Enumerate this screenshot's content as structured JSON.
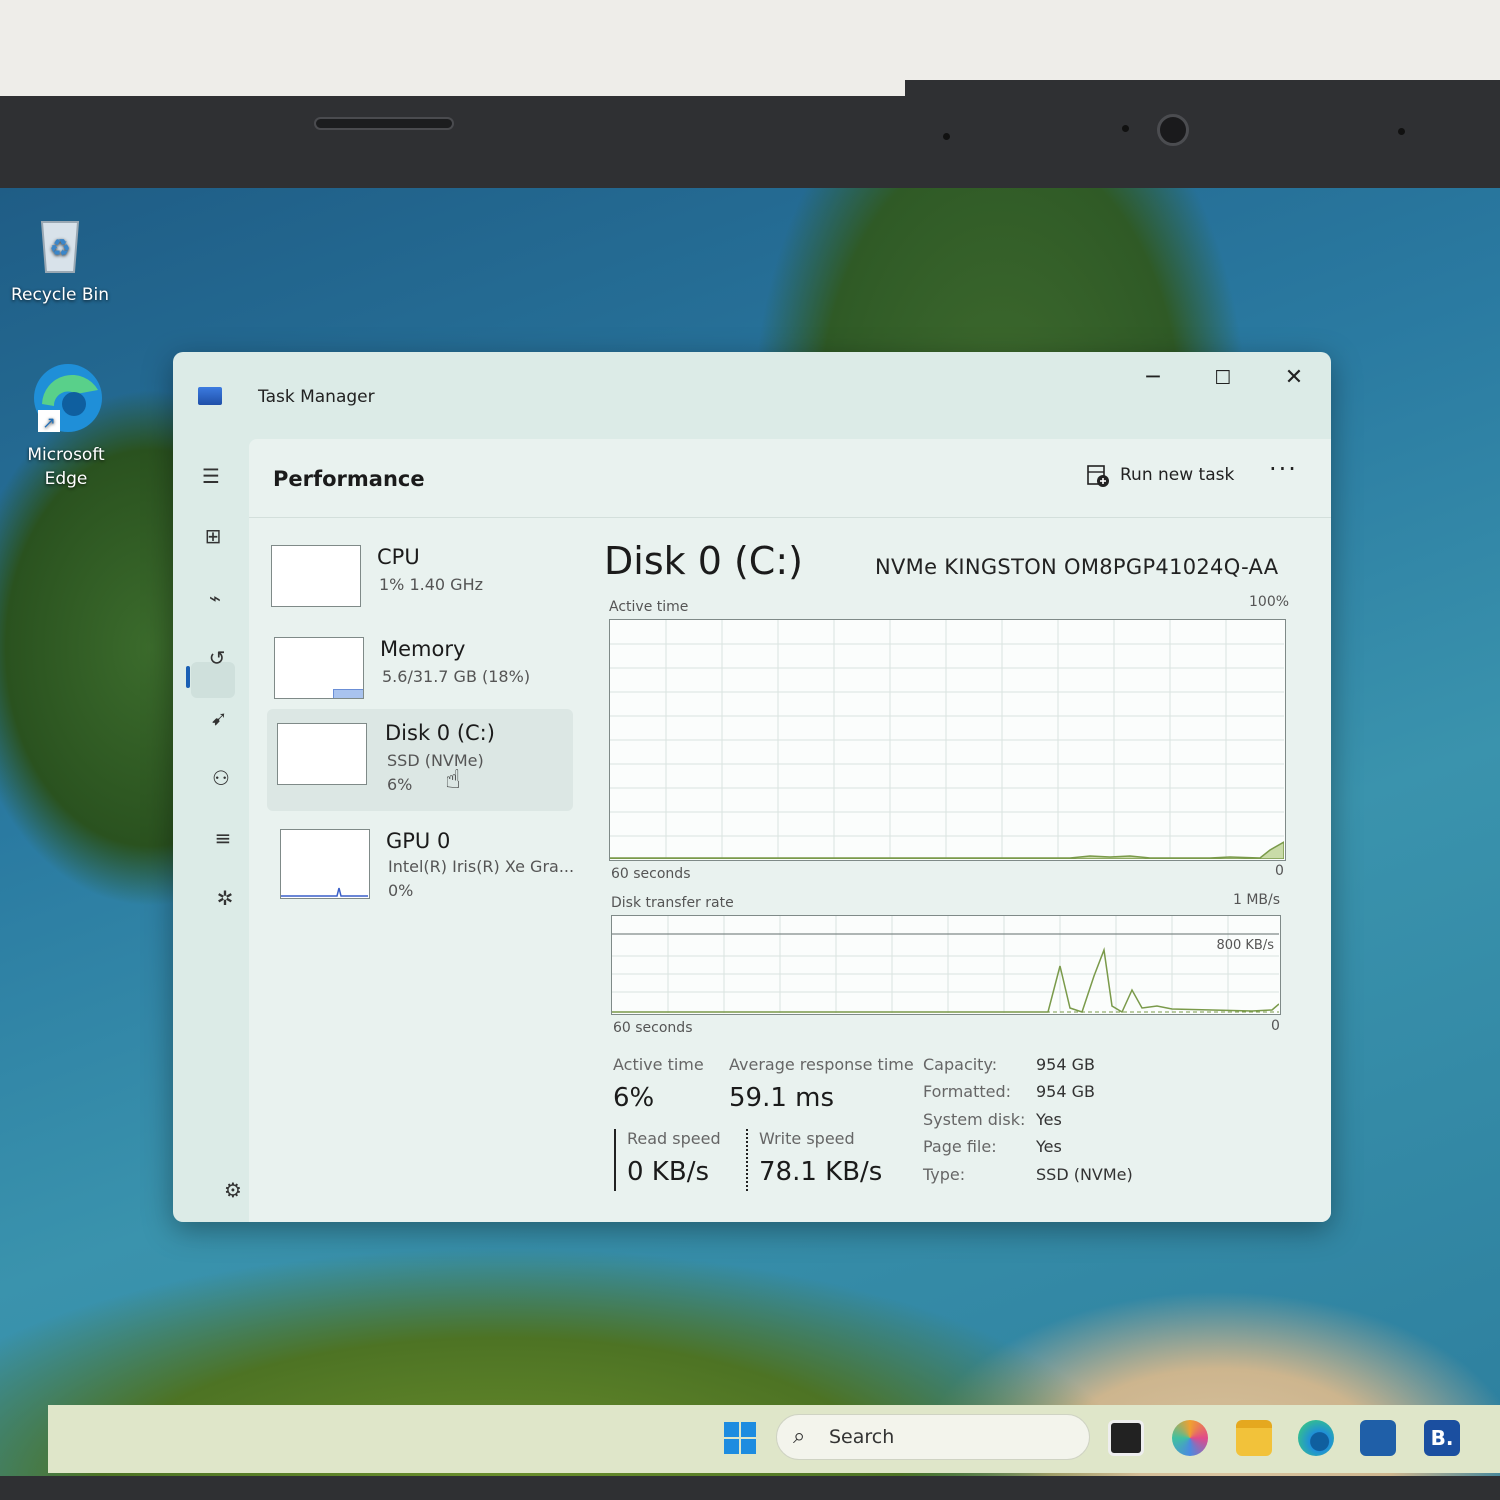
{
  "desktop": {
    "recycle_bin_label": "Recycle Bin",
    "edge_label_line1": "Microsoft",
    "edge_label_line2": "Edge"
  },
  "taskbar": {
    "search_placeholder": "Search",
    "store_badge": "B."
  },
  "window": {
    "title": "Task Manager",
    "minimize": "─",
    "maximize": "☐",
    "close": "✕"
  },
  "header": {
    "page_title": "Performance",
    "run_new_task": "Run new task",
    "more": "···"
  },
  "devices": [
    {
      "name": "CPU",
      "sub1": "1%  1.40 GHz",
      "sub2": ""
    },
    {
      "name": "Memory",
      "sub1": "5.6/31.7 GB (18%)",
      "sub2": ""
    },
    {
      "name": "Disk 0 (C:)",
      "sub1": "SSD (NVMe)",
      "sub2": "6%"
    },
    {
      "name": "GPU 0",
      "sub1": "Intel(R) Iris(R) Xe Gra...",
      "sub2": "0%"
    }
  ],
  "disk": {
    "title": "Disk 0 (C:)",
    "model": "NVMe KINGSTON OM8PGP41024Q-AA",
    "active_graph": {
      "label": "Active time",
      "max": "100%",
      "time": "60 seconds",
      "min": "0"
    },
    "transfer_graph": {
      "label": "Disk transfer rate",
      "max": "1 MB/s",
      "ref": "800 KB/s",
      "time": "60 seconds",
      "min": "0"
    },
    "stats": {
      "active_time_label": "Active time",
      "active_time": "6%",
      "avg_resp_label": "Average response time",
      "avg_resp": "59.1 ms",
      "read_label": "Read speed",
      "read": "0 KB/s",
      "write_label": "Write speed",
      "write": "78.1 KB/s"
    },
    "props": [
      {
        "k": "Capacity:",
        "v": "954 GB"
      },
      {
        "k": "Formatted:",
        "v": "954 GB"
      },
      {
        "k": "System disk:",
        "v": "Yes"
      },
      {
        "k": "Page file:",
        "v": "Yes"
      },
      {
        "k": "Type:",
        "v": "SSD (NVMe)"
      }
    ]
  },
  "colors": {
    "accent": "#1a5fb4",
    "disk_graph": "#7a9a4a",
    "memory_graph": "#6b8fd6",
    "gpu_graph": "#3a5fc8"
  }
}
